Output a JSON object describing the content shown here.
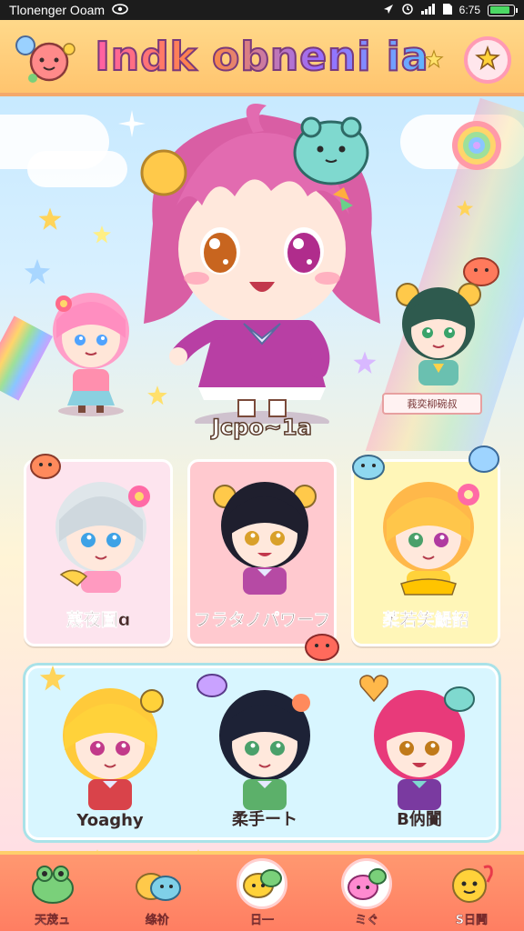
{
  "status_bar": {
    "app_name": "Tlonenger Ooam",
    "time": "6:75",
    "battery_level": 0.85
  },
  "header": {
    "title": "Indk obneni ia"
  },
  "hero": {
    "main_character_name": "Jcpo~1a",
    "side_tag": "莪奕柳碗叔"
  },
  "cards_row1": [
    {
      "name": "蔑夜圁ɑ",
      "bg": "#fde4ee"
    },
    {
      "name": "フラタノパワーフ",
      "bg": "#ffc9cf"
    },
    {
      "name": "葇若笑鯷韶",
      "bg": "#fff6b8"
    }
  ],
  "cards_row2": [
    {
      "name": "Yoaghy"
    },
    {
      "name": "柔手ート"
    },
    {
      "name": "Β㐻闠"
    }
  ],
  "bottom_nav": [
    {
      "label": "天荗ュ",
      "active": false
    },
    {
      "label": "绦祄",
      "active": false
    },
    {
      "label": "日一",
      "active": true
    },
    {
      "label": "ミぐ",
      "active": true
    },
    {
      "label": "S日闁",
      "active": false
    }
  ],
  "colors": {
    "header_bg": "#ffc46e",
    "nav_bg": "#ff7e62",
    "accent_pink": "#ff5fa8"
  }
}
